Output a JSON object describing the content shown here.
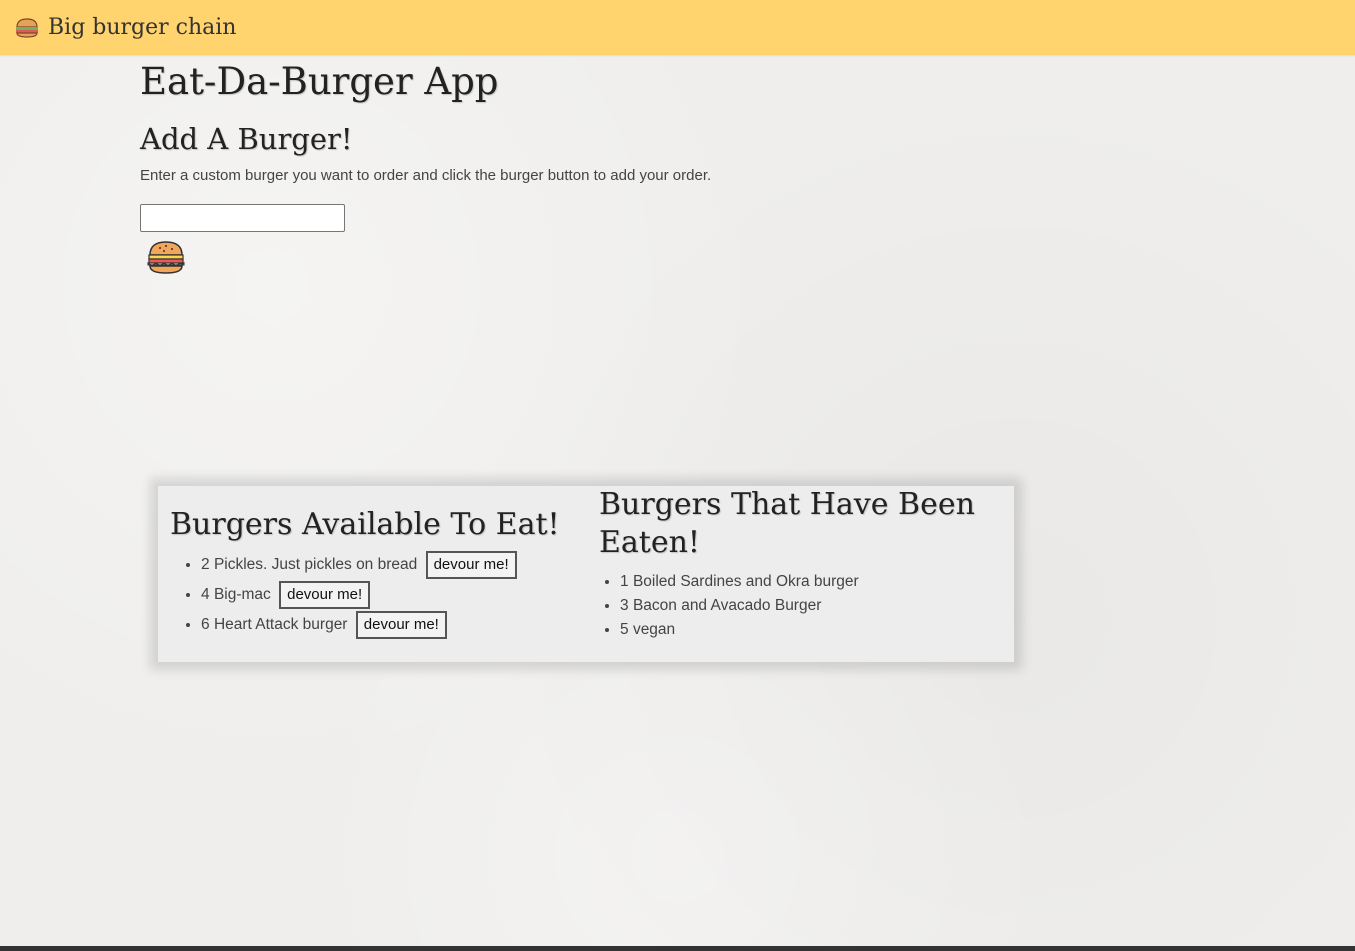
{
  "navbar": {
    "brand_text": "Big burger chain",
    "brand_icon": "burger-icon",
    "background": "#ffd36e"
  },
  "main": {
    "title": "Eat-Da-Burger App",
    "add_heading": "Add A Burger!",
    "instructions": "Enter a custom burger you want to order and click the burger button to add your order.",
    "burger_input": {
      "value": "",
      "placeholder": ""
    },
    "submit_icon": "burger-icon"
  },
  "available": {
    "heading": "Burgers Available To Eat!",
    "button_label": "devour me!",
    "items": [
      {
        "id": "2",
        "name": "Pickles. Just pickles on bread"
      },
      {
        "id": "4",
        "name": "Big-mac"
      },
      {
        "id": "6",
        "name": "Heart Attack burger"
      }
    ]
  },
  "eaten": {
    "heading": "Burgers That Have Been Eaten!",
    "items": [
      {
        "id": "1",
        "name": "Boiled Sardines and Okra burger"
      },
      {
        "id": "3",
        "name": "Bacon and Avacado Burger"
      },
      {
        "id": "5",
        "name": "vegan"
      }
    ]
  }
}
